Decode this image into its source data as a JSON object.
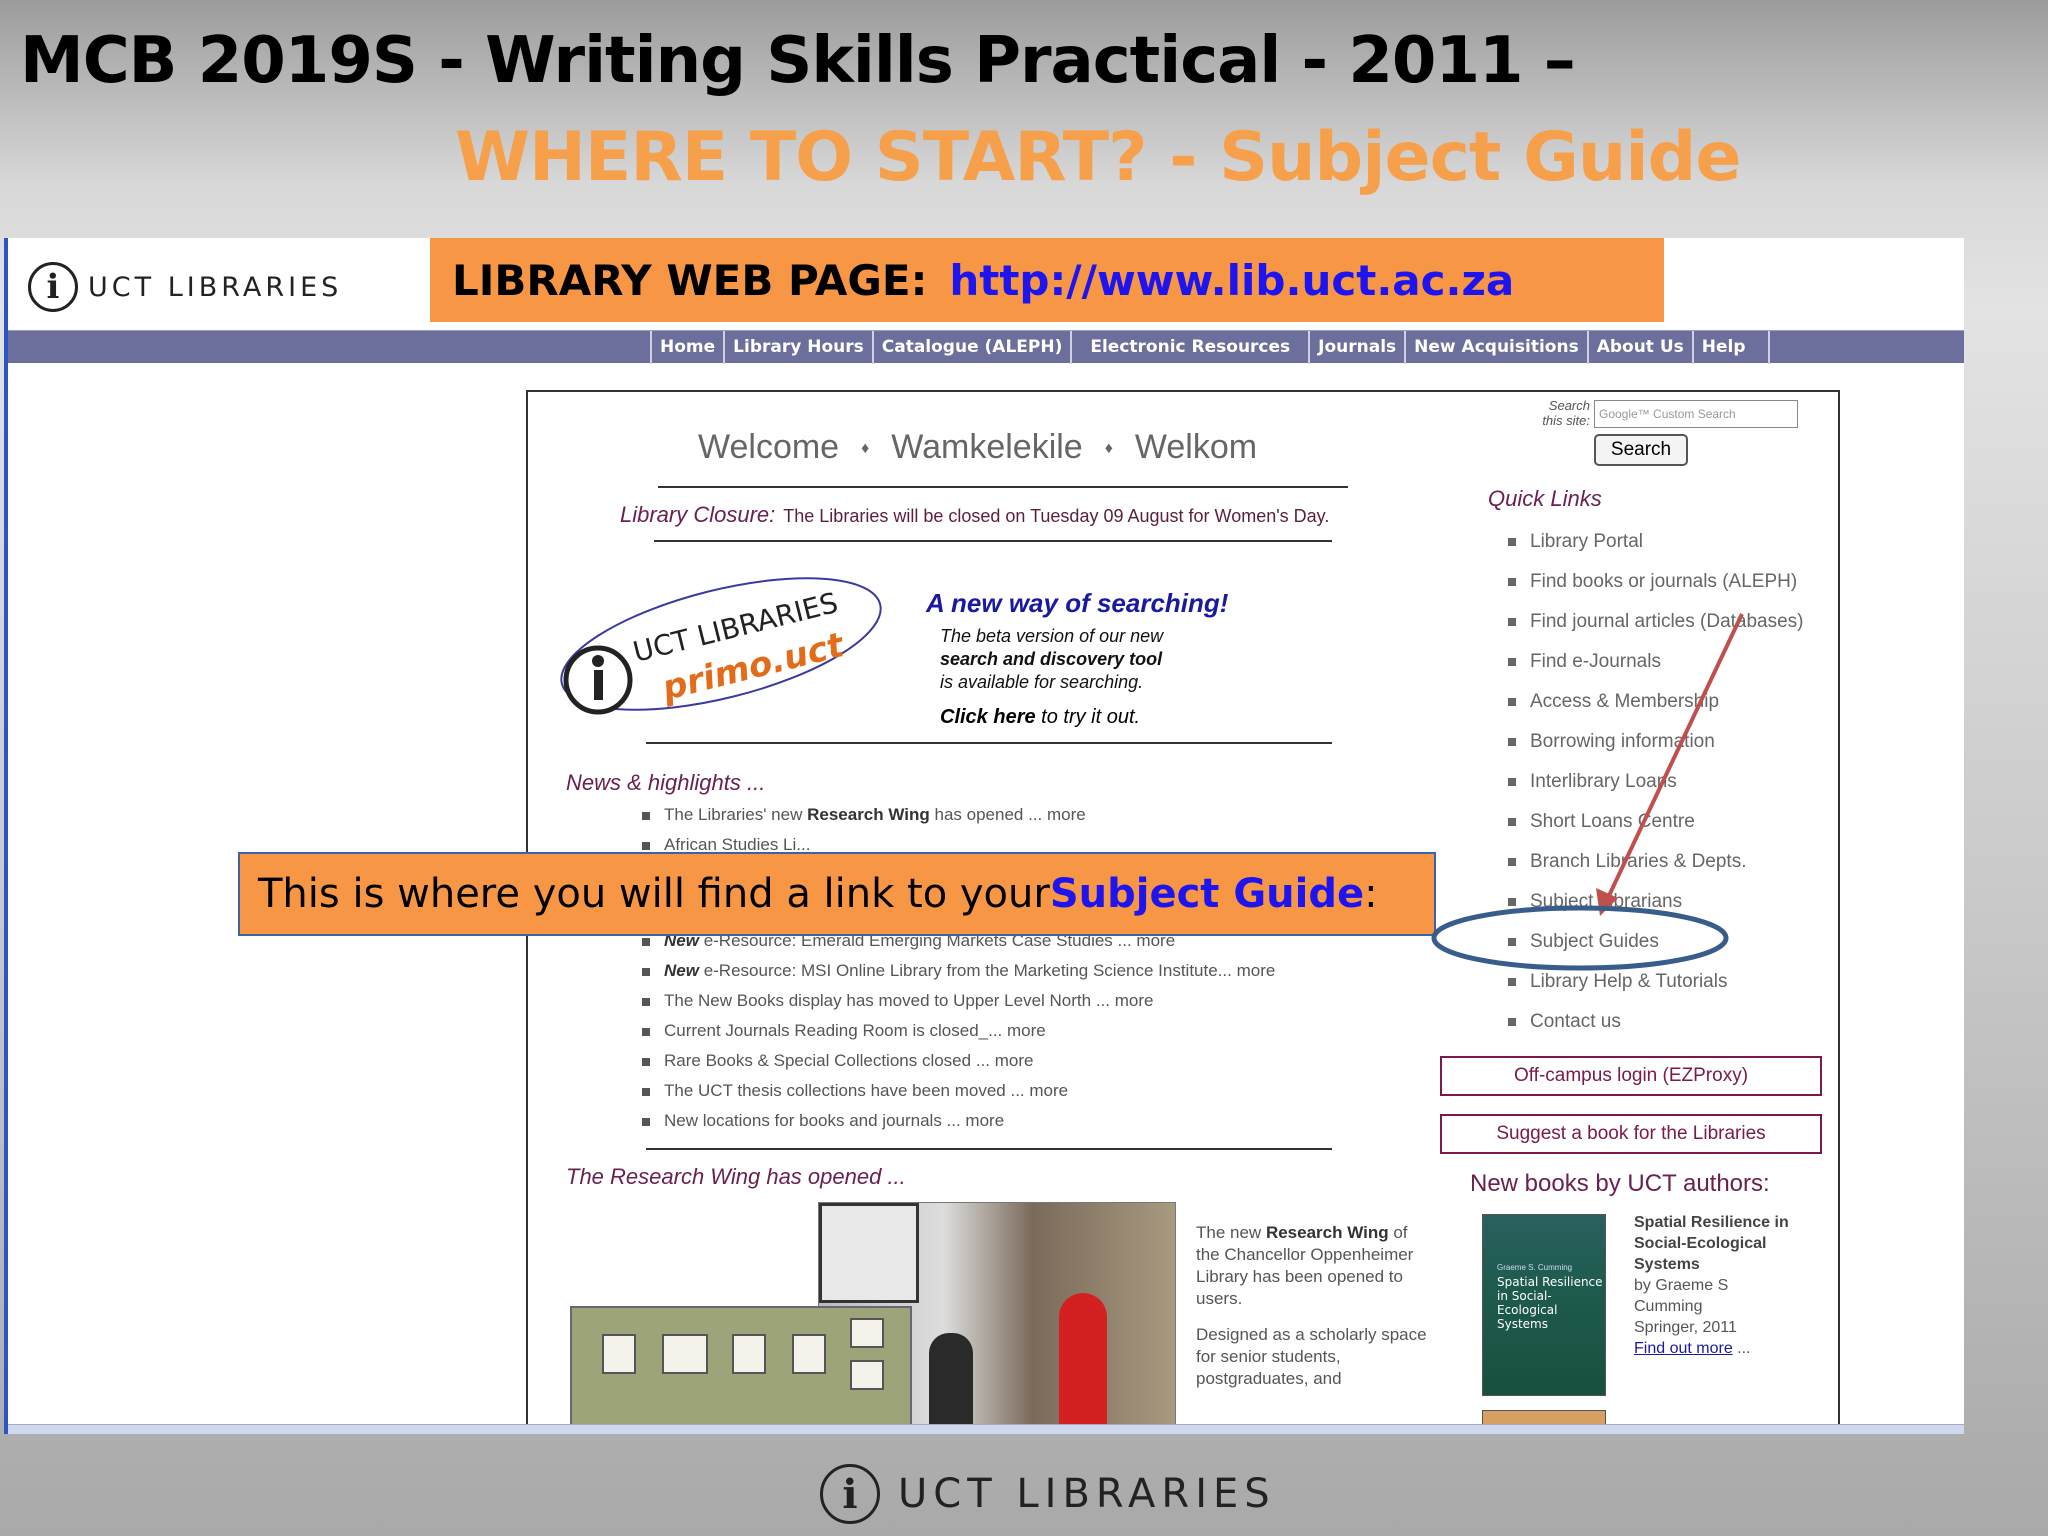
{
  "slide": {
    "title": "MCB 2019S  - Writing Skills Practical -  2011 –",
    "subtitle": "WHERE TO START? - Subject Guide"
  },
  "banner": {
    "label": "LIBRARY WEB PAGE:",
    "url": "http://www.lib.uct.ac.za"
  },
  "site": {
    "logo_text": "UCT  LIBRARIES",
    "logo_glyph": "i",
    "nav": [
      "Home",
      "Library Hours",
      "Catalogue (ALEPH)",
      "Electronic Resources",
      "Journals",
      "New Acquisitions",
      "About Us",
      "Help"
    ],
    "welcome": [
      "Welcome",
      "Wamkelekile",
      "Welkom"
    ],
    "welcome_sep": "♦",
    "closure_label": "Library Closure:",
    "closure_text": "The Libraries will be closed on Tuesday 09 August for Women's Day.",
    "primo": {
      "logo_line1": "UCT LIBRARIES",
      "logo_line2": "primo.uct",
      "headline": "A new way of searching!",
      "body_1": "The beta version of our new",
      "body_2": "search and discovery tool",
      "body_3": "is available for searching.",
      "click_bold": "Click here",
      "click_rest": " to try it out."
    },
    "news_head": "News & highlights ...",
    "news_first_a": "The Libraries' new ",
    "news_first_b": "Research Wing",
    "news_first_c": " has opened ... more",
    "news_partial": "African Studies Li...",
    "news": [
      {
        "new": "New",
        "text": " e-Resource: Emerald Emerging Markets Case Studies ... more"
      },
      {
        "new": "New",
        "text": " e-Resource: MSI Online Library from the Marketing Science Institute... more"
      },
      {
        "new": "",
        "text": "The New Books display has moved to Upper Level North ... more"
      },
      {
        "new": "",
        "text": "Current Journals Reading Room is closed_... more"
      },
      {
        "new": "",
        "text": "Rare Books & Special Collections closed ... more"
      },
      {
        "new": "",
        "text": "The UCT thesis collections have been moved ... more"
      },
      {
        "new": "",
        "text": "New locations for books and journals ... more"
      }
    ],
    "research_head": "The Research Wing has opened ...",
    "research_p1_a": "The new ",
    "research_p1_b": "Research Wing",
    "research_p1_c": " of the Chancellor Oppenheimer Library has been opened to users.",
    "research_p2": "Designed as a scholarly space for senior students, postgraduates, and",
    "search": {
      "label": "Search this site:",
      "placeholder": "Google™ Custom Search",
      "button": "Search"
    },
    "quick_links_head": "Quick Links",
    "quick_links": [
      "Library Portal",
      "Find books or journals (ALEPH)",
      "Find journal articles (Databases)",
      "Find e-Journals",
      "Access & Membership",
      "Borrowing information",
      "Interlibrary Loans",
      "Short Loans Centre",
      "Branch Libraries & Depts.",
      "Subject Librarians",
      "Subject Guides",
      "Library Help & Tutorials",
      "Contact us"
    ],
    "ezproxy": "Off-campus login (EZProxy)",
    "suggest": "Suggest a book for the Libraries",
    "new_books_head": "New books by UCT authors:",
    "book": {
      "cover_small": "Graeme S. Cumming",
      "cover_title": "Spatial Resilience in Social-Ecological Systems",
      "title": "Spatial Resilience in Social-Ecological Systems",
      "author": "by Graeme S Cumming",
      "publisher": "Springer, 2011",
      "link": "Find out more",
      "ellipsis": " ..."
    }
  },
  "callout": {
    "text_a": "This is where you will find a link to your ",
    "text_b": "Subject Guide",
    "text_c": ":"
  },
  "footer": {
    "logo_text": "UCT  LIBRARIES"
  },
  "colors": {
    "orange": "#f79645",
    "link_blue": "#1d14f0",
    "nav_bg": "#6c6e9c",
    "annotation_red": "#c0504d",
    "annotation_blue": "#385d8a"
  }
}
